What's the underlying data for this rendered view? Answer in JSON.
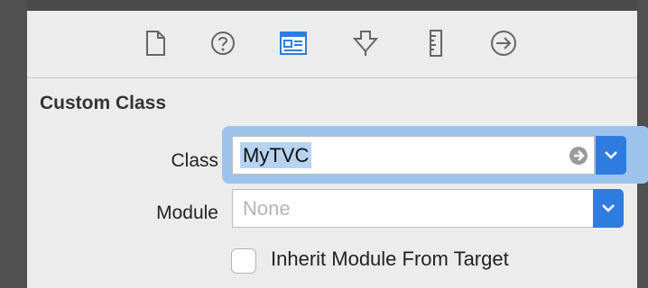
{
  "toolbar": {
    "tabs": [
      {
        "name": "file-inspector",
        "icon": "document-icon"
      },
      {
        "name": "quick-help",
        "icon": "question-circle-icon"
      },
      {
        "name": "identity-inspector",
        "icon": "identity-card-icon",
        "selected": true
      },
      {
        "name": "attributes-inspector",
        "icon": "attributes-arrow-icon"
      },
      {
        "name": "size-inspector",
        "icon": "ruler-icon"
      },
      {
        "name": "connections-inspector",
        "icon": "arrow-circle-icon"
      }
    ],
    "accent": "#2f7ce0"
  },
  "custom_class": {
    "title": "Custom Class",
    "class_label": "Class",
    "class_value": "MyTVC",
    "module_label": "Module",
    "module_placeholder": "None",
    "inherit_label": "Inherit Module From Target",
    "inherit_checked": false
  }
}
